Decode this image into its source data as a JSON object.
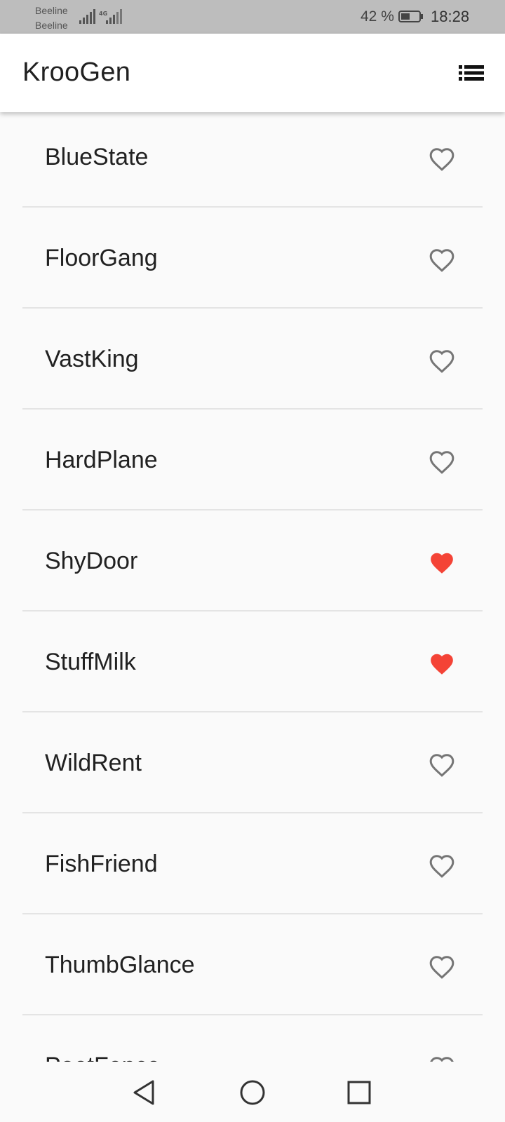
{
  "status_bar": {
    "carrier_1": "Beeline",
    "carrier_2": "Beeline",
    "network_type": "4G",
    "battery_percent": "42 %",
    "time": "18:28"
  },
  "app_bar": {
    "title": "KrooGen",
    "menu_icon": "list-icon"
  },
  "colors": {
    "accent_heart": "#f44336",
    "outline_heart": "#757575",
    "app_bar": "#ffffff",
    "background": "#fafafa"
  },
  "names": [
    {
      "label": "BlueState",
      "favorite": false
    },
    {
      "label": "FloorGang",
      "favorite": false
    },
    {
      "label": "VastKing",
      "favorite": false
    },
    {
      "label": "HardPlane",
      "favorite": false
    },
    {
      "label": "ShyDoor",
      "favorite": true
    },
    {
      "label": "StuffMilk",
      "favorite": true
    },
    {
      "label": "WildRent",
      "favorite": false
    },
    {
      "label": "FishFriend",
      "favorite": false
    },
    {
      "label": "ThumbGlance",
      "favorite": false
    },
    {
      "label": "PoetFence",
      "favorite": false
    }
  ],
  "nav_bar": {
    "back_icon": "back-triangle-icon",
    "home_icon": "home-circle-icon",
    "recents_icon": "recents-square-icon"
  }
}
